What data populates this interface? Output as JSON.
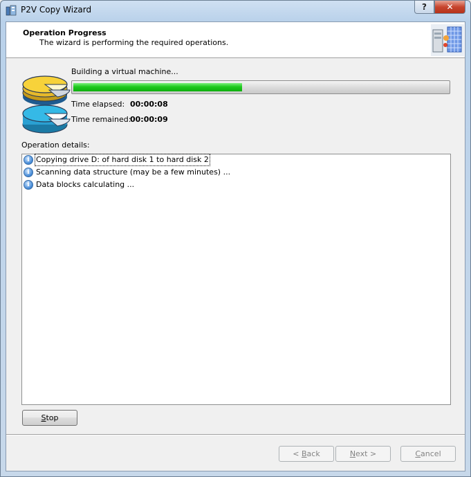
{
  "window": {
    "title": "P2V Copy Wizard",
    "help_label": "?",
    "close_label": "✕"
  },
  "header": {
    "title": "Operation Progress",
    "subtitle": "The wizard is performing the required operations."
  },
  "progress": {
    "status": "Building a virtual machine...",
    "fraction": 0.45,
    "elapsed_label": "Time elapsed:",
    "elapsed_value": "00:00:08",
    "remained_label": "Time remained:",
    "remained_value": "00:00:09"
  },
  "details": {
    "label": "Operation details:",
    "items": [
      {
        "icon": "info-icon",
        "text": "Copying drive D: of hard disk 1 to hard disk 2"
      },
      {
        "icon": "info-icon",
        "text": "Scanning data structure (may be a few minutes) ..."
      },
      {
        "icon": "info-icon",
        "text": "Data blocks calculating ..."
      }
    ]
  },
  "buttons": {
    "stop": {
      "mnemonic": "S",
      "rest": "top"
    },
    "back": {
      "prefix": "< ",
      "mnemonic": "B",
      "rest": "ack"
    },
    "next": {
      "mnemonic": "N",
      "rest": "ext >"
    },
    "cancel": {
      "mnemonic": "C",
      "rest": "ancel"
    }
  },
  "colors": {
    "progress_fill": "#1ec81e",
    "disk_top": "#f7d23a",
    "disk_bottom": "#35b9e6"
  }
}
